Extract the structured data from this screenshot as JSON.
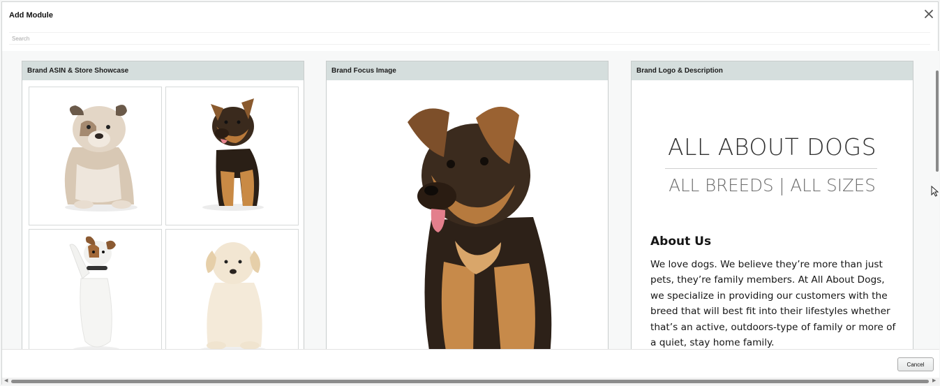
{
  "modal": {
    "title": "Add Module",
    "search_placeholder": "Search",
    "cancel_label": "Cancel"
  },
  "modules": [
    {
      "title": "Brand ASIN & Store Showcase",
      "tiles": [
        {
          "image": "bulldog-puppy"
        },
        {
          "image": "german-shepherd-puppy"
        },
        {
          "image": "jack-russell-terrier-jumping"
        },
        {
          "image": "yellow-labrador-puppy"
        }
      ]
    },
    {
      "title": "Brand Focus Image",
      "image": "german-shepherd-puppy"
    },
    {
      "title": "Brand Logo & Description",
      "brand_name": "ALL ABOUT DOGS",
      "tagline": "ALL BREEDS | ALL SIZES",
      "about_heading": "About Us",
      "about_text": "We love dogs. We believe they’re more than just pets, they’re family members. At All About Dogs, we specialize in providing our customers with the breed that will best fit into their lifestyles whether that’s an active, outdoors-type of family or more of a quiet, stay home family."
    }
  ],
  "colors": {
    "card_header": "#d5dedd",
    "scrollbar_thumb": "#8c8c8c"
  },
  "icons": [
    "close-icon",
    "mouse-cursor-icon",
    "scroll-left-arrow-icon",
    "scroll-right-arrow-icon"
  ]
}
